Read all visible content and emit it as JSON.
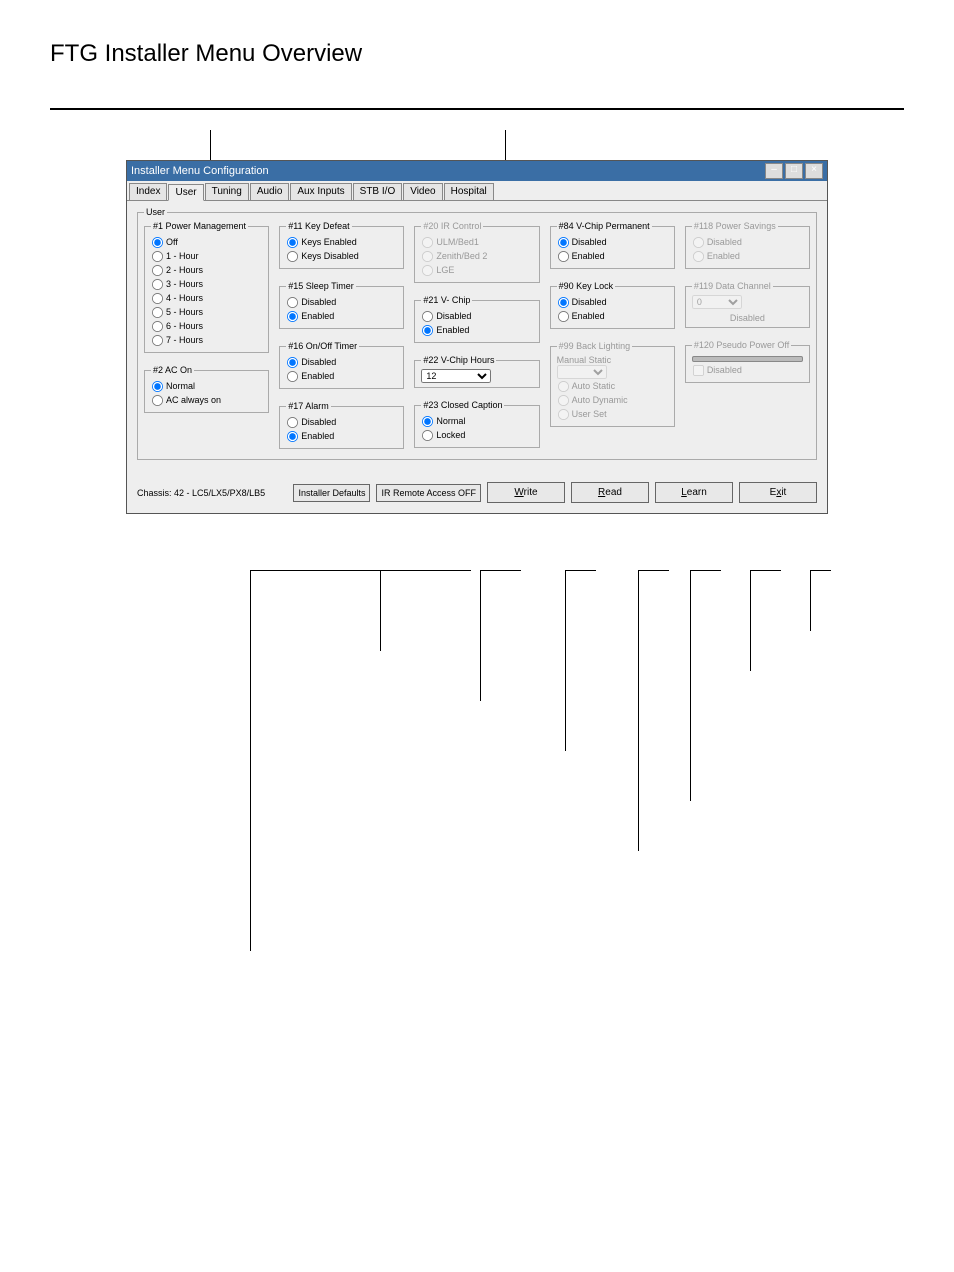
{
  "pageTitle": "FTG Installer Menu Overview",
  "window": {
    "title": "Installer Menu Configuration",
    "tabs": [
      "Index",
      "User",
      "Tuning",
      "Audio",
      "Aux Inputs",
      "STB I/O",
      "Video",
      "Hospital"
    ],
    "selectedTab": 1,
    "groupLabel": "User"
  },
  "g1": {
    "legend": "#1 Power Management",
    "opts": [
      "Off",
      "1 - Hour",
      "2 - Hours",
      "3 - Hours",
      "4 - Hours",
      "5 - Hours",
      "6 - Hours",
      "7 - Hours"
    ],
    "sel": 0
  },
  "g2": {
    "legend": "#2 AC On",
    "opts": [
      "Normal",
      "AC always on"
    ],
    "sel": 0
  },
  "g11": {
    "legend": "#11 Key Defeat",
    "opts": [
      "Keys Enabled",
      "Keys Disabled"
    ],
    "sel": 0
  },
  "g15": {
    "legend": "#15 Sleep Timer",
    "opts": [
      "Disabled",
      "Enabled"
    ],
    "sel": 1
  },
  "g16": {
    "legend": "#16 On/Off Timer",
    "opts": [
      "Disabled",
      "Enabled"
    ],
    "sel": 0
  },
  "g17": {
    "legend": "#17 Alarm",
    "opts": [
      "Disabled",
      "Enabled"
    ],
    "sel": 1
  },
  "g20": {
    "legend": "#20 IR Control",
    "opts": [
      "ULM/Bed1",
      "Zenith/Bed 2",
      "LGE"
    ],
    "sel": 0
  },
  "g21": {
    "legend": "#21 V- Chip",
    "opts": [
      "Disabled",
      "Enabled"
    ],
    "sel": 1
  },
  "g22": {
    "legend": "#22 V-Chip Hours",
    "value": "12"
  },
  "g23": {
    "legend": "#23 Closed Caption",
    "opts": [
      "Normal",
      "Locked"
    ],
    "sel": 0
  },
  "g84": {
    "legend": "#84 V-Chip Permanent",
    "opts": [
      "Disabled",
      "Enabled"
    ],
    "sel": 0
  },
  "g90": {
    "legend": "#90 Key Lock",
    "opts": [
      "Disabled",
      "Enabled"
    ],
    "sel": 0
  },
  "g99": {
    "legend": "#99 Back Lighting",
    "sub": "Manual Static",
    "opts": [
      "Auto Static",
      "Auto Dynamic",
      "User Set"
    ]
  },
  "g118": {
    "legend": "#118 Power Savings",
    "opts": [
      "Disabled",
      "Enabled"
    ],
    "sel": 0
  },
  "g119": {
    "legend": "#119 Data Channel",
    "value": "0",
    "status": "Disabled"
  },
  "g120": {
    "legend": "#120 Pseudo Power Off",
    "chk": "Disabled"
  },
  "footer": {
    "chassisLabel": "Chassis:",
    "chassisValue": "42 - LC5/LX5/PX8/LB5",
    "installerDefaults": "Installer Defaults",
    "irRemote": "IR Remote Access OFF",
    "write": "Write",
    "read": "Read",
    "learn": "Learn",
    "exit": "Exit"
  }
}
